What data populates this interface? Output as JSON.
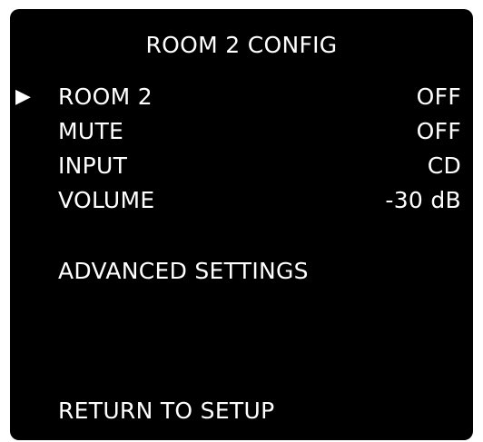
{
  "screen": {
    "title": "ROOM 2 CONFIG",
    "cursor_glyph": "▶",
    "items": [
      {
        "label": "ROOM 2",
        "value": "OFF",
        "selected": true
      },
      {
        "label": "MUTE",
        "value": "OFF"
      },
      {
        "label": "INPUT",
        "value": "CD"
      },
      {
        "label": "VOLUME",
        "value": "-30 dB"
      }
    ],
    "advanced_label": "ADVANCED SETTINGS",
    "return_label": "RETURN TO SETUP"
  },
  "colors": {
    "background": "#000000",
    "text": "#ffffff",
    "page": "#ffffff"
  }
}
